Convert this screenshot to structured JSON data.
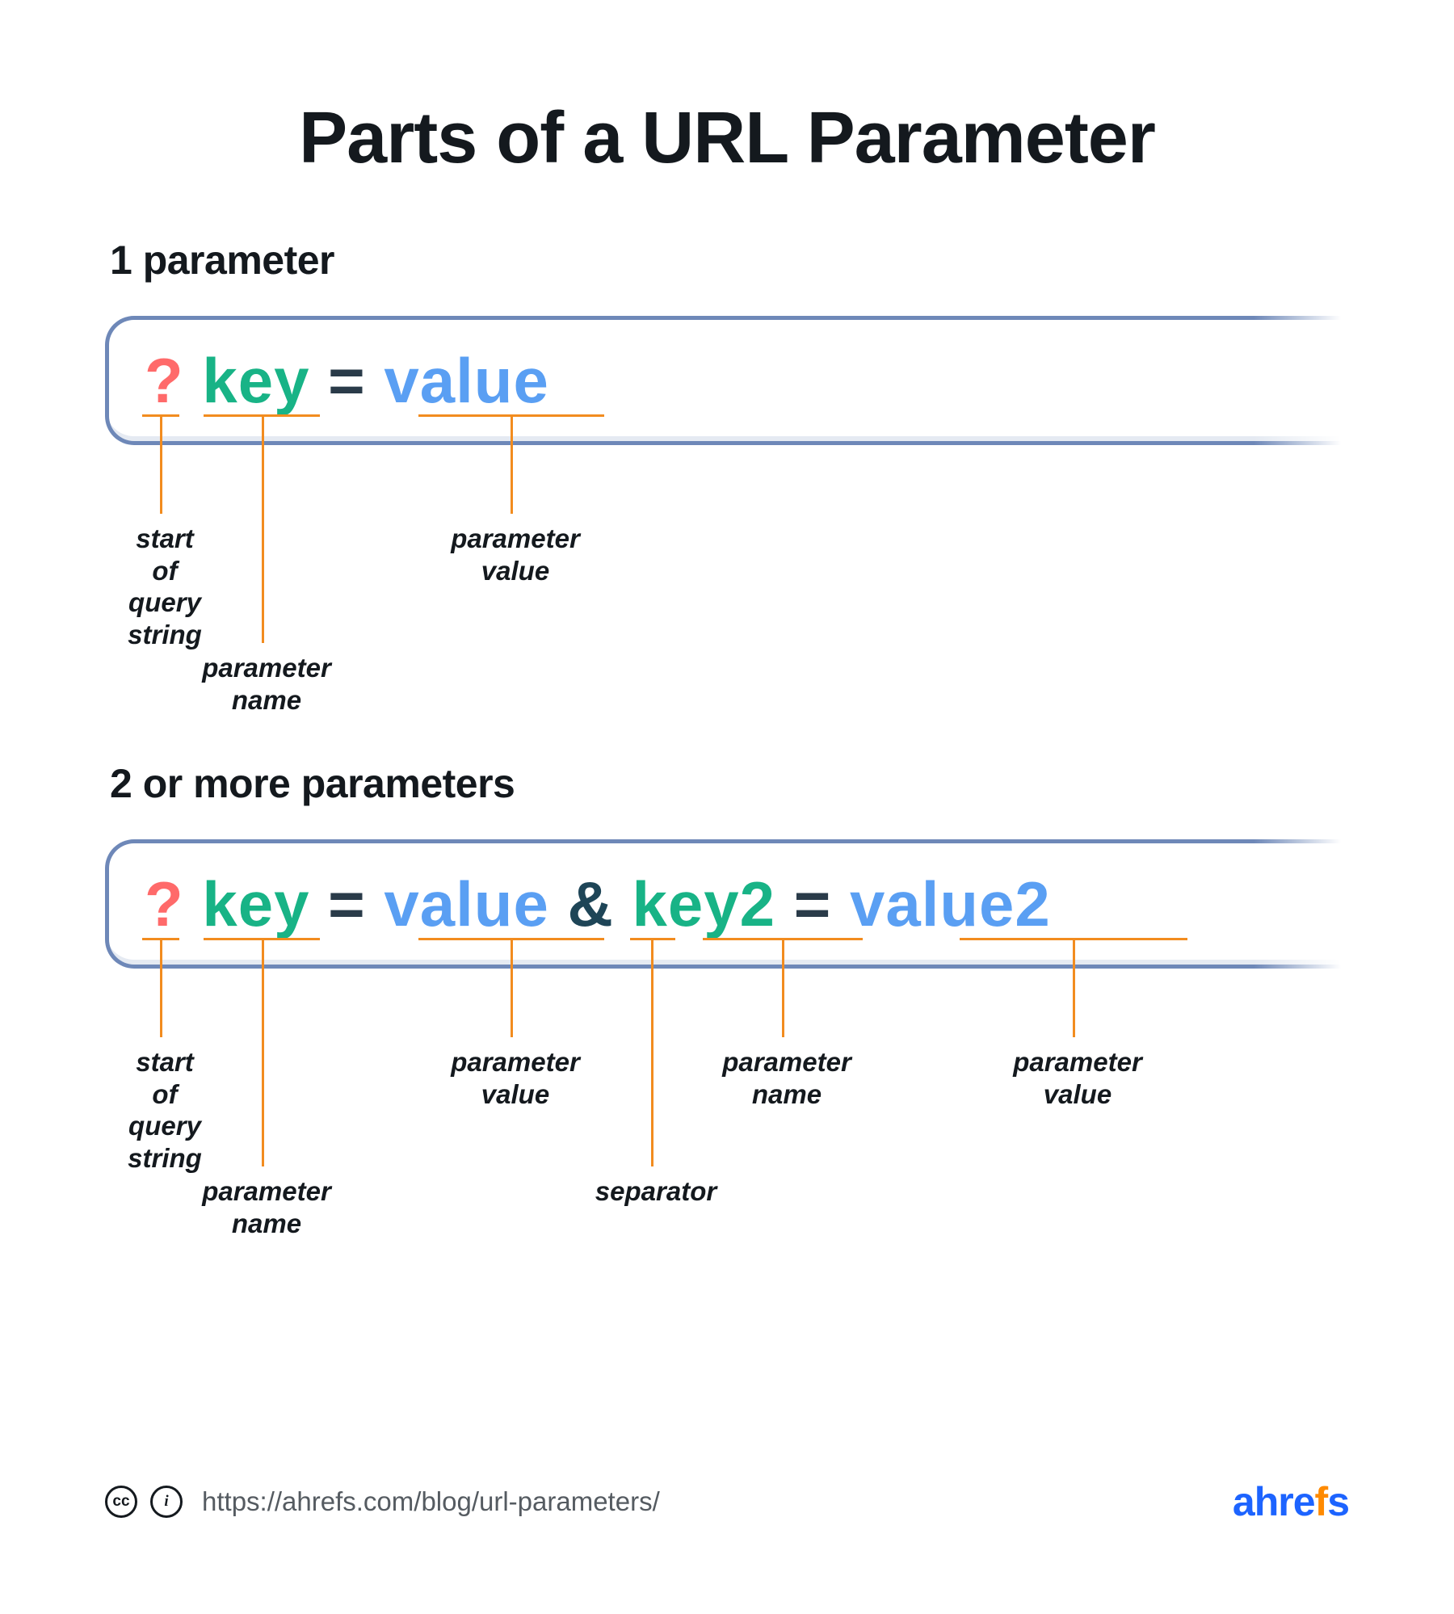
{
  "title": "Parts of a URL Parameter",
  "section1": {
    "heading": "1 parameter",
    "tokens": {
      "qmark": "?",
      "key": "key",
      "eq": "=",
      "value": "value"
    },
    "labels": {
      "start": "start of\nquery\nstring",
      "pname": "parameter\nname",
      "pvalue": "parameter\nvalue"
    }
  },
  "section2": {
    "heading": "2 or more parameters",
    "tokens": {
      "qmark": "?",
      "key": "key",
      "eq": "=",
      "value": "value",
      "amp": "&",
      "key2": "key2",
      "eq2": "=",
      "value2": "value2"
    },
    "labels": {
      "start": "start of\nquery\nstring",
      "pname": "parameter\nname",
      "pvalue": "parameter\nvalue",
      "separator": "separator",
      "pname2": "parameter\nname",
      "pvalue2": "parameter\nvalue"
    }
  },
  "footer": {
    "cc": "cc",
    "by": "i",
    "source": "https://ahrefs.com/blog/url-parameters/",
    "brand_a": "ahre",
    "brand_f": "f",
    "brand_s": "s"
  },
  "colors": {
    "qmark": "#ff6a6a",
    "key": "#18b386",
    "eq": "#2a3b49",
    "value": "#5a9ff3",
    "amp": "#1e4557",
    "leader": "#f28c1f",
    "barBorder": "#6e88b8",
    "brandBlue": "#1d64ff",
    "brandOrange": "#ff8a00"
  }
}
